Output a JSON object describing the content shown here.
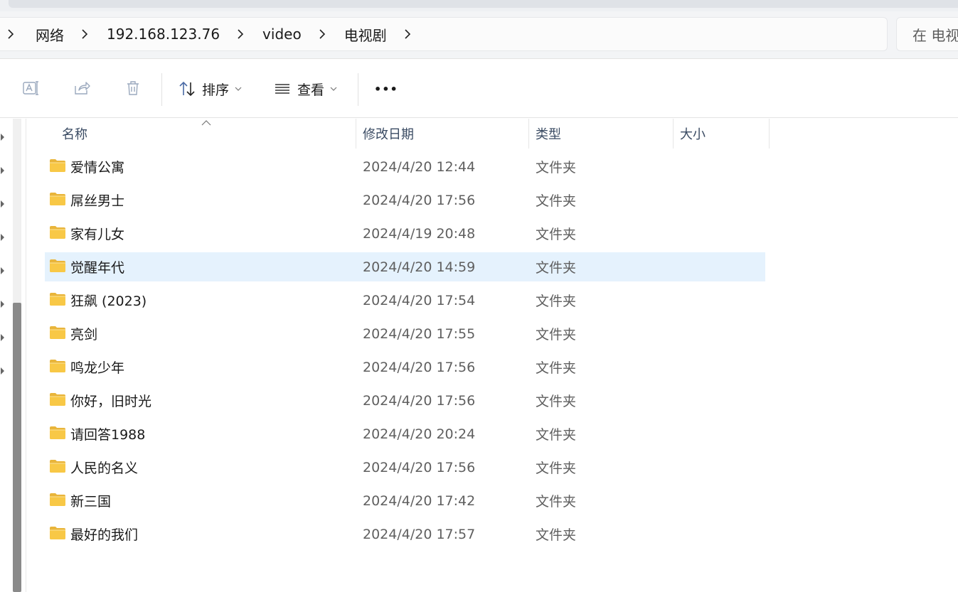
{
  "address": {
    "crumbs": [
      "网络",
      "192.168.123.76",
      "video",
      "电视剧"
    ],
    "search_placeholder": "在 电视"
  },
  "toolbar": {
    "sort_label": "排序",
    "view_label": "查看",
    "more_label": "•••"
  },
  "columns": {
    "name": "名称",
    "modified": "修改日期",
    "type": "类型",
    "size": "大小"
  },
  "files": [
    {
      "name": "爱情公寓",
      "modified": "2024/4/20 12:44",
      "type": "文件夹"
    },
    {
      "name": "屌丝男士",
      "modified": "2024/4/20 17:56",
      "type": "文件夹"
    },
    {
      "name": "家有儿女",
      "modified": "2024/4/19 20:48",
      "type": "文件夹"
    },
    {
      "name": "觉醒年代",
      "modified": "2024/4/20 14:59",
      "type": "文件夹"
    },
    {
      "name": "狂飙 (2023)",
      "modified": "2024/4/20 17:54",
      "type": "文件夹"
    },
    {
      "name": "亮剑",
      "modified": "2024/4/20 17:55",
      "type": "文件夹"
    },
    {
      "name": "鸣龙少年",
      "modified": "2024/4/20 17:56",
      "type": "文件夹"
    },
    {
      "name": "你好，旧时光",
      "modified": "2024/4/20 17:56",
      "type": "文件夹"
    },
    {
      "name": "请回答1988",
      "modified": "2024/4/20 20:24",
      "type": "文件夹"
    },
    {
      "name": "人民的名义",
      "modified": "2024/4/20 17:56",
      "type": "文件夹"
    },
    {
      "name": "新三国",
      "modified": "2024/4/20 17:42",
      "type": "文件夹"
    },
    {
      "name": "最好的我们",
      "modified": "2024/4/20 17:57",
      "type": "文件夹"
    }
  ],
  "colors": {
    "selection": "#e5f2fd",
    "folder": "#f8c846",
    "header_text": "#3a4b63"
  },
  "icons": {
    "rename": "rename-icon",
    "share": "share-icon",
    "delete": "trash-icon",
    "sort": "sort-icon",
    "view": "view-list-icon",
    "folder": "folder-icon"
  }
}
